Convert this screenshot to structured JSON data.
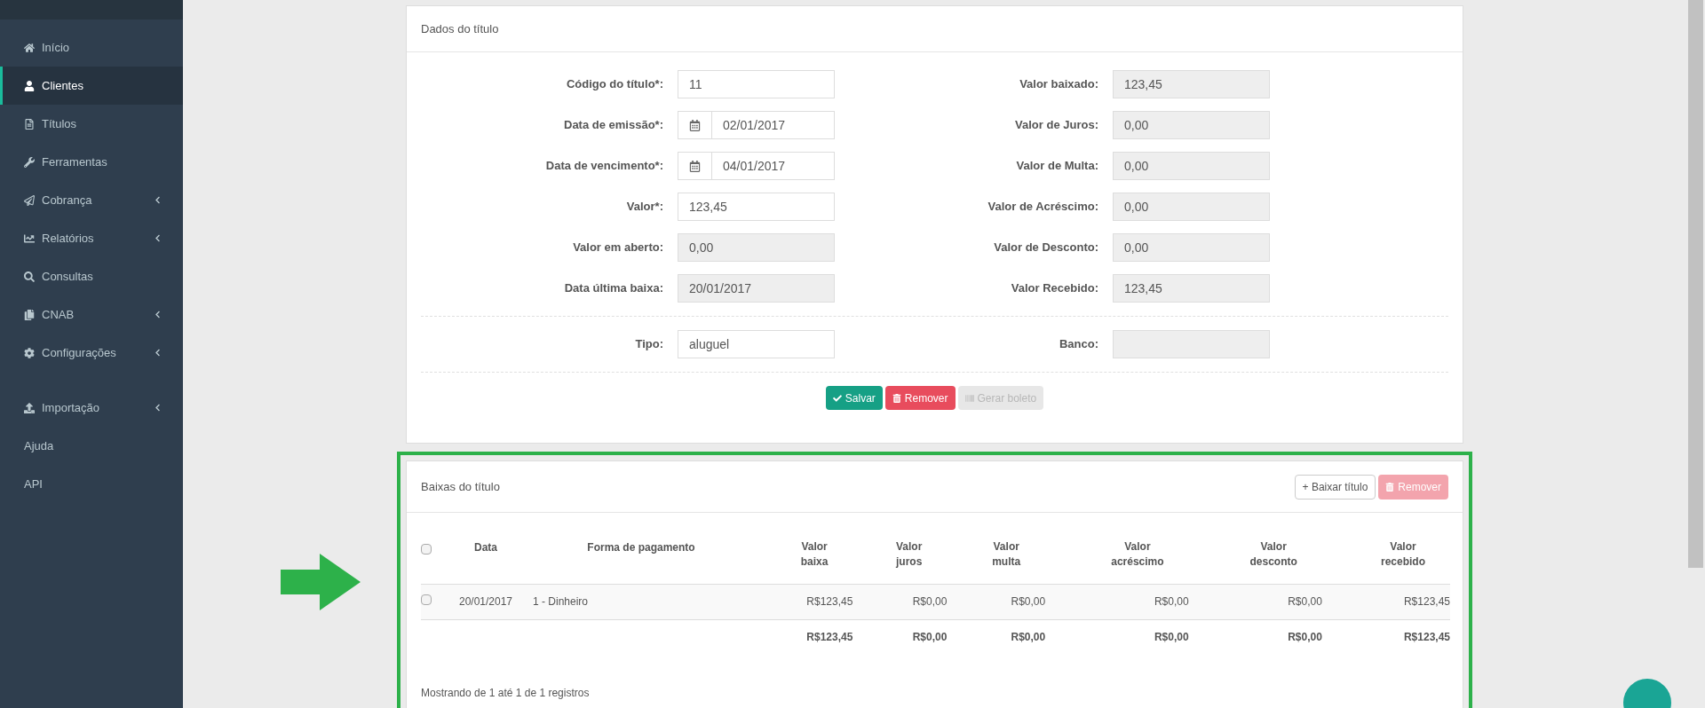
{
  "sidebar": {
    "sections": [
      {
        "items": [
          {
            "label": "Início",
            "selected": false,
            "expandable": false
          },
          {
            "label": "Clientes",
            "selected": true,
            "expandable": false
          },
          {
            "label": "Títulos",
            "selected": false,
            "expandable": false
          },
          {
            "label": "Ferramentas",
            "selected": false,
            "expandable": false
          },
          {
            "label": "Cobrança",
            "selected": false,
            "expandable": true
          },
          {
            "label": "Relatórios",
            "selected": false,
            "expandable": true
          },
          {
            "label": "Consultas",
            "selected": false,
            "expandable": false
          },
          {
            "label": "CNAB",
            "selected": false,
            "expandable": true
          },
          {
            "label": "Configurações",
            "selected": false,
            "expandable": true
          }
        ]
      },
      {
        "items": [
          {
            "label": "Importação",
            "selected": false,
            "expandable": true
          },
          {
            "label": "Ajuda",
            "selected": false,
            "expandable": false
          },
          {
            "label": "API",
            "selected": false,
            "expandable": false
          }
        ]
      }
    ]
  },
  "title_panel": {
    "title": "Dados do título",
    "rows": [
      {
        "left": {
          "label": "Código do título*:",
          "value": "11",
          "disabled": false
        },
        "right": {
          "label": "Valor baixado:",
          "value": "123,45",
          "disabled": true
        }
      },
      {
        "left": {
          "label": "Data de emissão*:",
          "value": "02/01/2017",
          "kind": "date",
          "disabled": false
        },
        "right": {
          "label": "Valor de Juros:",
          "value": "0,00",
          "disabled": true
        }
      },
      {
        "left": {
          "label": "Data de vencimento*:",
          "value": "04/01/2017",
          "kind": "date",
          "disabled": false
        },
        "right": {
          "label": "Valor de Multa:",
          "value": "0,00",
          "disabled": true
        }
      },
      {
        "left": {
          "label": "Valor*:",
          "value": "123,45",
          "disabled": false
        },
        "right": {
          "label": "Valor de Acréscimo:",
          "value": "0,00",
          "disabled": true
        }
      },
      {
        "left": {
          "label": "Valor em aberto:",
          "value": "0,00",
          "disabled": true
        },
        "right": {
          "label": "Valor de Desconto:",
          "value": "0,00",
          "disabled": true
        }
      },
      {
        "left": {
          "label": "Data última baixa:",
          "value": "20/01/2017",
          "disabled": true
        },
        "right": {
          "label": "Valor Recebido:",
          "value": "123,45",
          "disabled": true
        }
      }
    ],
    "extra_row": {
      "left": {
        "label": "Tipo:",
        "value": "aluguel",
        "disabled": false
      },
      "right": {
        "label": "Banco:",
        "disabled": true
      }
    },
    "buttons": [
      {
        "label": "Salvar",
        "kind": "save",
        "disabled": false
      },
      {
        "label": "Remover",
        "kind": "remove",
        "disabled": false
      },
      {
        "label": "Gerar boleto",
        "kind": "boleto",
        "disabled": true
      }
    ]
  },
  "payments_panel": {
    "title": "Baixas do título",
    "highlighted": true,
    "buttons": [
      {
        "label": "+ Baixar título",
        "kind": "add",
        "disabled": false
      },
      {
        "label": "Remover",
        "kind": "remove",
        "disabled": true
      }
    ],
    "table": {
      "columns": [
        "Data",
        "Forma de pagamento",
        "Valor\nbaixa",
        "Valor\njuros",
        "Valor\nmulta",
        "Valor\nacréscimo",
        "Valor\ndesconto",
        "Valor\nrecebido"
      ],
      "select_all_checked": false,
      "rows": [
        {
          "checked": false,
          "cells": [
            "20/01/2017",
            "1 - Dinheiro",
            "R$123,45",
            "R$0,00",
            "R$0,00",
            "R$0,00",
            "R$0,00",
            "R$123,45"
          ]
        }
      ],
      "totals": [
        "R$123,45",
        "R$0,00",
        "R$0,00",
        "R$0,00",
        "R$0,00",
        "R$123,45"
      ]
    },
    "footer": "Mostrando de 1 até 1 de 1 registros"
  }
}
